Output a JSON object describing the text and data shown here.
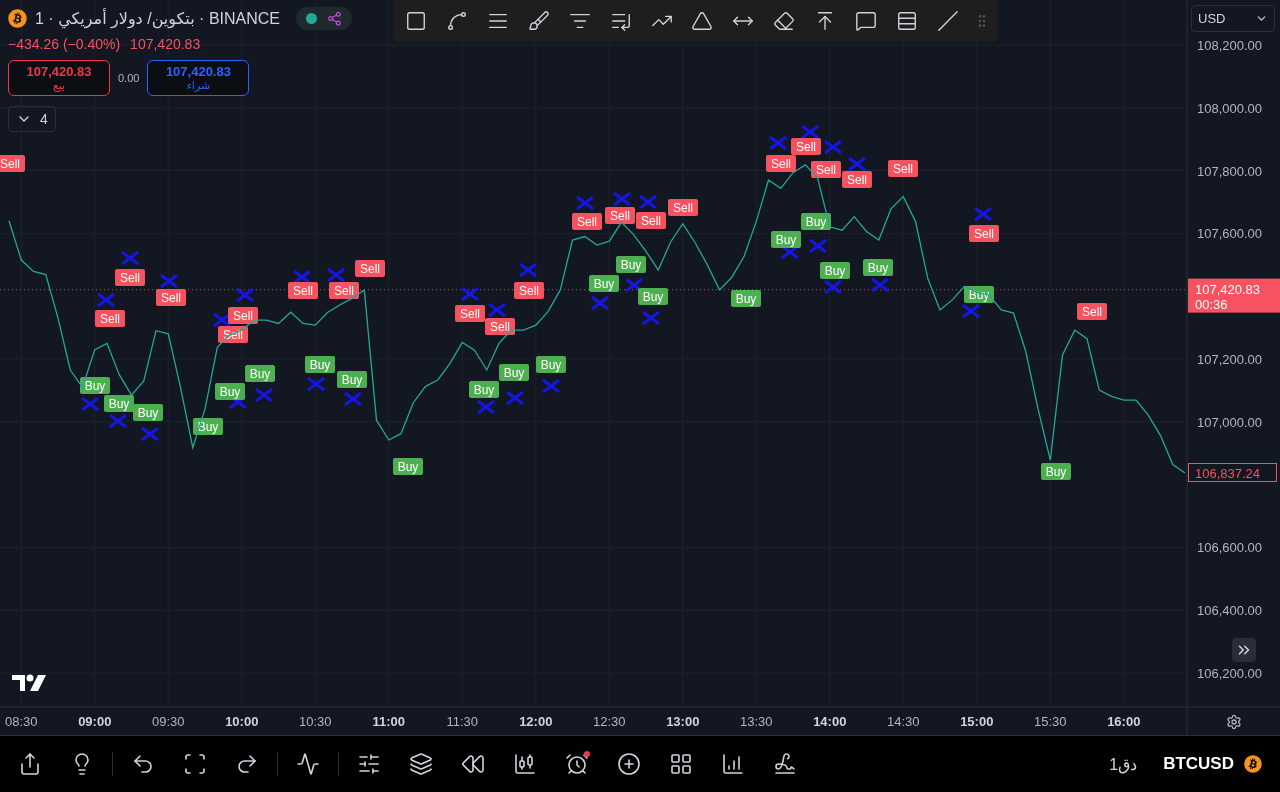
{
  "header": {
    "title": "بتكوين/ دولار أمريكي · 1 · BINANCE",
    "change": "−434.26 (−0.40%)",
    "last_price": "107,420.83"
  },
  "trade": {
    "sell": {
      "price": "107,420.83",
      "label": "بيع"
    },
    "spread": "0.00",
    "buy": {
      "price": "107,420.83",
      "label": "شراء"
    }
  },
  "indicators_toggle": {
    "count": "4"
  },
  "drawing_tools": [
    {
      "kind": "rectangle"
    },
    {
      "kind": "ray"
    },
    {
      "kind": "fib"
    },
    {
      "kind": "brush"
    },
    {
      "kind": "channel"
    },
    {
      "kind": "pitchfork"
    },
    {
      "kind": "path"
    },
    {
      "kind": "arc"
    },
    {
      "kind": "measure"
    },
    {
      "kind": "eraser"
    },
    {
      "kind": "range"
    },
    {
      "kind": "comment"
    },
    {
      "kind": "gann"
    },
    {
      "kind": "line"
    }
  ],
  "currency": "USD",
  "chart": {
    "chart_data": {
      "type": "line",
      "categories": [
        null,
        "08:30",
        null,
        null,
        null,
        null,
        null,
        "09:00",
        null,
        null,
        null,
        null,
        null,
        "09:30",
        null,
        null,
        null,
        null,
        null,
        "10:00",
        null,
        null,
        null,
        null,
        null,
        "10:30",
        null,
        null,
        null,
        null,
        null,
        "11:00",
        null,
        null,
        null,
        null,
        null,
        "11:30",
        null,
        null,
        null,
        null,
        null,
        "12:00",
        null,
        null,
        null,
        null,
        null,
        "12:30",
        null,
        null,
        null,
        null,
        null,
        "13:00",
        null,
        null,
        null,
        null,
        null,
        "13:30",
        null,
        null,
        null,
        null,
        null,
        "14:00",
        null,
        null,
        null,
        null,
        null,
        "14:30",
        null,
        null,
        null,
        null,
        null,
        "15:00",
        null,
        null,
        null,
        null,
        null,
        "15:30",
        null,
        null,
        null,
        null,
        null,
        "16:00",
        null,
        null,
        null,
        null,
        null
      ],
      "series": [
        {
          "color": "#26a69a",
          "values": [
            107640,
            107515,
            107479,
            107469,
            107330,
            107165,
            107110,
            107230,
            107250,
            107150,
            107085,
            107130,
            107290,
            107280,
            107110,
            106918,
            107040,
            107237,
            107276,
            107292,
            107324,
            107324,
            107313,
            107349,
            107313,
            107308,
            107348,
            107372,
            107393,
            107420,
            107005,
            106942,
            106962,
            107061,
            107113,
            107133,
            107186,
            107253,
            107228,
            107165,
            107250,
            107292,
            107292,
            107308,
            107351,
            107420,
            107579,
            107590,
            107563,
            107575,
            107635,
            107595,
            107543,
            107483,
            107572,
            107631,
            107571,
            107500,
            107420,
            107460,
            107526,
            107638,
            107770,
            107743,
            107793,
            107818,
            107778,
            107621,
            107610,
            107653,
            107606,
            107579,
            107678,
            107717,
            107638,
            107456,
            107356,
            107388,
            107431,
            107412,
            107404,
            107356,
            107346,
            107224,
            107042,
            106878,
            107213,
            107292,
            107265,
            107101,
            107081,
            107069,
            107069,
            107021,
            106956,
            106864,
            106837
          ]
        }
      ],
      "ylim": [
        106092,
        108343
      ],
      "yticks": [
        {
          "value": 108200,
          "label": "108,200.00"
        },
        {
          "value": 108000,
          "label": "108,000.00"
        },
        {
          "value": 107800,
          "label": "107,800.00"
        },
        {
          "value": 107600,
          "label": "107,600.00"
        },
        {
          "value": 107200,
          "label": "107,200.00"
        },
        {
          "value": 107000,
          "label": "107,000.00"
        },
        {
          "value": 106600,
          "label": "106,600.00"
        },
        {
          "value": 106400,
          "label": "106,400.00"
        },
        {
          "value": 106200,
          "label": "106,200.00"
        }
      ],
      "grid": true,
      "ref_lines": [
        {
          "axis": "y",
          "value": 107420.83
        }
      ]
    },
    "signals": [
      {
        "kind": "sell",
        "text": "Sell"
      },
      {
        "kind": "sell",
        "text": "Sell"
      },
      {
        "kind": "sell",
        "text": "Sell"
      },
      {
        "kind": "sell",
        "text": "Sell"
      },
      {
        "kind": "sell",
        "text": "Sell"
      },
      {
        "kind": "sell",
        "text": "Sell"
      },
      {
        "kind": "sell",
        "text": "Sell"
      },
      {
        "kind": "sell",
        "text": "Sell"
      },
      {
        "kind": "sell",
        "text": "Sell"
      },
      {
        "kind": "sell",
        "text": "Sell"
      },
      {
        "kind": "sell",
        "text": "Sell"
      },
      {
        "kind": "sell",
        "text": "Sell"
      },
      {
        "kind": "sell",
        "text": "Sell"
      },
      {
        "kind": "sell",
        "text": "Sell"
      },
      {
        "kind": "sell",
        "text": "Sell"
      },
      {
        "kind": "sell",
        "text": "Sell"
      },
      {
        "kind": "sell",
        "text": "Sell"
      },
      {
        "kind": "sell",
        "text": "Sell"
      },
      {
        "kind": "sell",
        "text": "Sell"
      },
      {
        "kind": "sell",
        "text": "Sell"
      },
      {
        "kind": "sell",
        "text": "Sell"
      },
      {
        "kind": "sell",
        "text": "Sell"
      },
      {
        "kind": "sell",
        "text": "Sell"
      },
      {
        "kind": "buy",
        "text": "Buy"
      },
      {
        "kind": "buy",
        "text": "Buy"
      },
      {
        "kind": "buy",
        "text": "Buy"
      },
      {
        "kind": "buy",
        "text": "Buy"
      },
      {
        "kind": "buy",
        "text": "Buy"
      },
      {
        "kind": "buy",
        "text": "Buy"
      },
      {
        "kind": "buy",
        "text": "Buy"
      },
      {
        "kind": "buy",
        "text": "Buy"
      },
      {
        "kind": "buy",
        "text": "Buy"
      },
      {
        "kind": "buy",
        "text": "Buy"
      },
      {
        "kind": "buy",
        "text": "Buy"
      },
      {
        "kind": "buy",
        "text": "Buy"
      },
      {
        "kind": "buy",
        "text": "Buy"
      },
      {
        "kind": "buy",
        "text": "Buy"
      },
      {
        "kind": "buy",
        "text": "Buy"
      },
      {
        "kind": "buy",
        "text": "Buy"
      },
      {
        "kind": "buy",
        "text": "Buy"
      },
      {
        "kind": "buy",
        "text": "Buy"
      },
      {
        "kind": "buy",
        "text": "Buy"
      },
      {
        "kind": "buy",
        "text": "Buy"
      },
      {
        "kind": "buy",
        "text": "Buy"
      },
      {
        "kind": "buy",
        "text": "Buy"
      }
    ],
    "price_tag": {
      "price": "107,420.83",
      "countdown": "00:36"
    },
    "close_tag": {
      "price": "106,837.24"
    }
  },
  "bottom_toolbar": [
    {
      "kind": "share",
      "badge": false
    },
    {
      "kind": "idea",
      "badge": false
    },
    {
      "kind": "separator"
    },
    {
      "kind": "undo",
      "badge": false
    },
    {
      "kind": "fullscreen",
      "badge": false
    },
    {
      "kind": "redo",
      "badge": false
    },
    {
      "kind": "separator"
    },
    {
      "kind": "indicators",
      "badge": false
    },
    {
      "kind": "separator"
    },
    {
      "kind": "settings",
      "badge": false
    },
    {
      "kind": "layers",
      "badge": false
    },
    {
      "kind": "replay",
      "badge": false
    },
    {
      "kind": "candles",
      "badge": false
    },
    {
      "kind": "alert",
      "badge": true
    },
    {
      "kind": "add",
      "badge": false
    },
    {
      "kind": "layout",
      "badge": false
    },
    {
      "kind": "chart",
      "badge": false
    },
    {
      "kind": "draw",
      "badge": false
    }
  ],
  "interval": "1دق",
  "symbol": "BTCUSD"
}
